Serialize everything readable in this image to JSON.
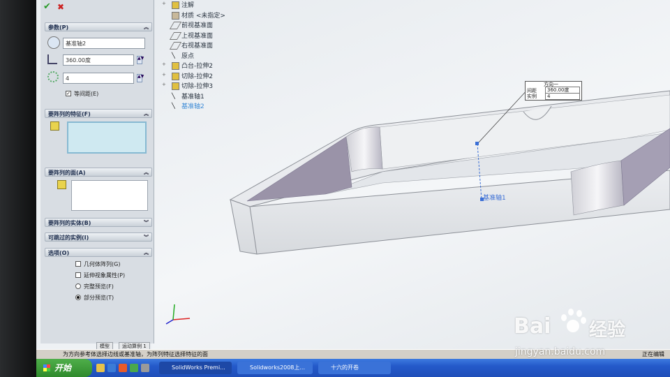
{
  "toolbar": {
    "ok_label": "✔",
    "cancel_label": "✖"
  },
  "parameters": {
    "title": "参数(P)",
    "axis_value": "基准轴2",
    "angle_value": "360.00度",
    "count_value": "4",
    "equal_spacing_label": "等间距(E)",
    "equal_spacing_checked": true
  },
  "features_section": {
    "title": "要阵列的特征(F)"
  },
  "faces_section": {
    "title": "要阵列的面(A)"
  },
  "bodies_section": {
    "title": "要阵列的实体(B)"
  },
  "skip_section": {
    "title": "可跳过的实例(I)"
  },
  "options": {
    "title": "选项(O)",
    "items": [
      {
        "label": "几何体阵列(G)",
        "type": "checkbox",
        "checked": false
      },
      {
        "label": "延伸视象属性(P)",
        "type": "checkbox",
        "checked": false
      },
      {
        "label": "完整预览(F)",
        "type": "radio",
        "checked": false
      },
      {
        "label": "部分预览(T)",
        "type": "radio",
        "checked": true
      }
    ]
  },
  "tree": [
    {
      "label": "注解",
      "icon": "annotation-icon",
      "expandable": true
    },
    {
      "label": "材质 <未指定>",
      "icon": "material-icon",
      "expandable": false
    },
    {
      "label": "前视基准面",
      "icon": "plane-icon",
      "expandable": false
    },
    {
      "label": "上视基准面",
      "icon": "plane-icon",
      "expandable": false
    },
    {
      "label": "右视基准面",
      "icon": "plane-icon",
      "expandable": false
    },
    {
      "label": "原点",
      "icon": "origin-icon",
      "expandable": false
    },
    {
      "label": "凸台-拉伸2",
      "icon": "extrude-icon",
      "expandable": true
    },
    {
      "label": "切除-拉伸2",
      "icon": "cut-icon",
      "expandable": true
    },
    {
      "label": "切除-拉伸3",
      "icon": "cut-icon",
      "expandable": true
    },
    {
      "label": "基准轴1",
      "icon": "axis-icon",
      "expandable": false
    },
    {
      "label": "基准轴2",
      "icon": "axis-icon",
      "expandable": false
    }
  ],
  "callout": {
    "title": "方向一",
    "spacing_label": "间距",
    "spacing_value": "360.00度",
    "instances_label": "实例",
    "instances_value": "4"
  },
  "axis_label": "基准轴1",
  "tabs": [
    "模型",
    "运动算例 1"
  ],
  "status": {
    "message": "为方向参考体选择边线或基准轴，为阵列特征选择特征的面",
    "right": "正在编辑"
  },
  "taskbar": {
    "start": "开始",
    "tasks": [
      "SolidWorks Premi...",
      "Solidworks2008上...",
      "十六的开卷"
    ]
  },
  "watermark": {
    "brand": "Bai",
    "brand2": "经验",
    "url": "jingyan.baidu.com"
  },
  "colors": {
    "accent": "#2a62d0",
    "highlight": "#86b9d2",
    "part": "#e9ecef",
    "inner": "#9a93a8"
  }
}
